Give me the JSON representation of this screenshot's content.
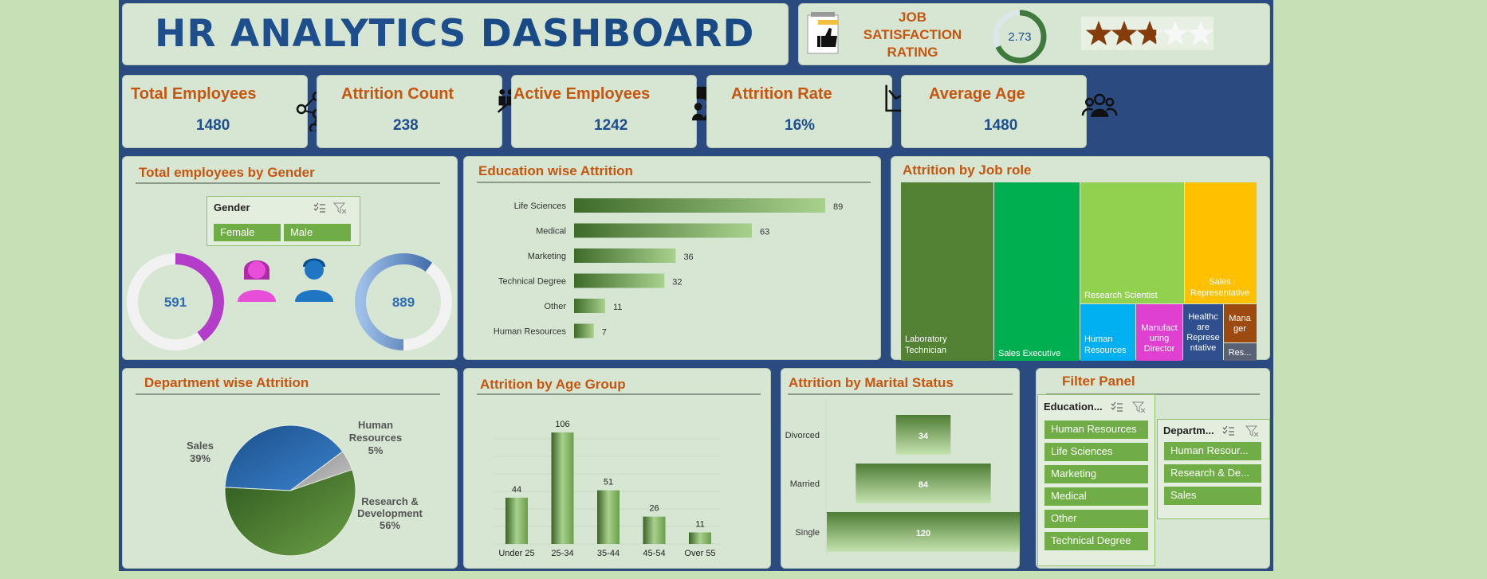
{
  "header": {
    "title_part1": "HR ANALYTICS",
    "title_part2": "DASHBOARD"
  },
  "job_satisfaction": {
    "label_line1": "JOB",
    "label_line2": "SATISFACTION",
    "label_line3": "RATING",
    "value": "2.73",
    "gauge_fraction": 0.68,
    "stars": 2.73,
    "stars_max": 5
  },
  "kpis": [
    {
      "label": "Total Employees",
      "value": "1480",
      "icon": "network-people-icon"
    },
    {
      "label": "Attrition Count",
      "value": "238",
      "icon": "people-trend-icon"
    },
    {
      "label": "Active Employees",
      "value": "1242",
      "icon": "meeting-people-icon"
    },
    {
      "label": "Attrition Rate",
      "value": "16%",
      "icon": "declining-chart-icon"
    },
    {
      "label": "Average Age",
      "value": "1480",
      "icon": "group-people-icon"
    }
  ],
  "gender": {
    "title": "Total employees by Gender",
    "slicer_title": "Gender",
    "options": [
      "Female",
      "Male"
    ],
    "female_value": "591",
    "male_value": "889",
    "female_fraction": 0.4,
    "male_fraction": 0.6
  },
  "education": {
    "title": "Education wise Attrition",
    "chart_data": {
      "type": "bar",
      "categories": [
        "Life Sciences",
        "Medical",
        "Marketing",
        "Technical Degree",
        "Other",
        "Human Resources"
      ],
      "values": [
        89,
        63,
        36,
        32,
        11,
        7
      ],
      "xlim": [
        0,
        100
      ]
    }
  },
  "job_role": {
    "title": "Attrition by Job role",
    "chart_data": {
      "type": "treemap",
      "categories": [
        "Laboratory Technician",
        "Sales Executive",
        "Research Scientist",
        "Sales Representative",
        "Human Resources",
        "Manufacturing Director",
        "Healthcare Representative",
        "Manager",
        "Research Director"
      ],
      "labels": [
        "Laboratory Technician",
        "",
        "Research Scientist",
        "Sales Representative",
        "Human Resources",
        "Manufact uring Director",
        "Healthc are Represe ntative",
        "Mana ger",
        "Res..."
      ],
      "colors": [
        "#548235",
        "#00b050",
        "#92d050",
        "#ffc000",
        "#00b0f0",
        "#e040d0",
        "#2f4f8f",
        "#9c4a10",
        "#596275"
      ]
    }
  },
  "department": {
    "title": "Department wise Attrition",
    "chart_data": {
      "type": "pie",
      "slices": [
        {
          "label": "Sales",
          "value": 39,
          "color": "#2e6db4"
        },
        {
          "label": "Human Resources",
          "value": 5,
          "color": "#a6a6a6"
        },
        {
          "label": "Research & Development",
          "value": 56,
          "color": "#548235"
        }
      ],
      "labels": {
        "sales": "Sales",
        "sales_pct": "39%",
        "hr1": "Human",
        "hr2": "Resources",
        "hr_pct": "5%",
        "rd1": "Research &",
        "rd2": "Development",
        "rd_pct": "56%"
      }
    }
  },
  "age_group": {
    "title": "Attrition by Age Group",
    "chart_data": {
      "type": "bar",
      "categories": [
        "Under 25",
        "25-34",
        "35-44",
        "45-54",
        "Over 55"
      ],
      "values": [
        44,
        106,
        51,
        26,
        11
      ],
      "ylim": [
        0,
        120
      ]
    }
  },
  "marital": {
    "title": "Attrition by Marital Status",
    "chart_data": {
      "type": "bar",
      "categories": [
        "Divorced",
        "Married",
        "Single"
      ],
      "values": [
        34,
        84,
        120
      ],
      "xlim": [
        0,
        120
      ]
    }
  },
  "filter_panel": {
    "title": "Filter Panel",
    "education_slicer": {
      "title": "Education...",
      "options": [
        "Human Resources",
        "Life Sciences",
        "Marketing",
        "Medical",
        "Other",
        "Technical Degree"
      ]
    },
    "department_slicer": {
      "title": "Departm...",
      "options": [
        "Human Resour...",
        "Research & De...",
        "Sales"
      ]
    }
  },
  "colors": {
    "accent_orange": "#c5560f",
    "title_blue": "#1f4e8c",
    "green": "#548235",
    "background": "#2a4a80",
    "female_pink": "#e040d0",
    "male_blue": "#1f77c4"
  }
}
